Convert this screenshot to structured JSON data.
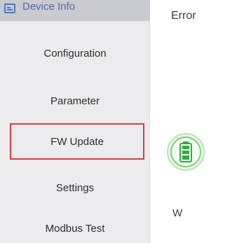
{
  "sidebar": {
    "items": [
      {
        "label": "Device Info",
        "icon": "device-info-icon",
        "state": "selected"
      },
      {
        "label": "Configuration"
      },
      {
        "label": "Parameter"
      },
      {
        "label": "FW Update",
        "state": "highlighted"
      },
      {
        "label": "Settings"
      },
      {
        "label": "Modbus Test"
      }
    ]
  },
  "main": {
    "error_label": "Error",
    "unit_label": "W",
    "battery_icon": "battery-charging-icon"
  },
  "colors": {
    "sidebar_bg": "#ececee",
    "selected_bg": "#c9cbd0",
    "selected_text": "#5a64a8",
    "highlight_border": "#e0393e",
    "battery_green": "#2fae3a"
  }
}
